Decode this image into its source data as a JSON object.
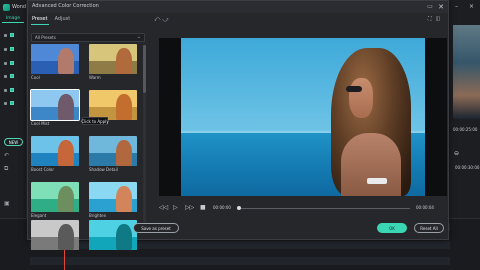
{
  "app": {
    "title_partial": "Wond"
  },
  "background": {
    "left_tab": "Image",
    "new_button": "NEW",
    "right_time_1": "00:00:25:00",
    "right_time_2": "00:00:30:00",
    "window_min": "–",
    "window_close": "×"
  },
  "dialog": {
    "title": "Advanced Color Correction",
    "minimize": "▭",
    "close": "✕",
    "tabs": [
      {
        "label": "Preset",
        "active": true
      },
      {
        "label": "Adjust",
        "active": false
      }
    ],
    "preset_filter": {
      "value": "All Presets"
    },
    "presets": [
      {
        "label": "Cool",
        "sky": "#4f88d6",
        "sea": "#2a5fb3",
        "girl": "#b27a6a"
      },
      {
        "label": "Warm",
        "sky": "#d6c57a",
        "sea": "#8f7b45",
        "girl": "#b06a3c"
      },
      {
        "label": "Cool Mist",
        "sky": "#8ec7ef",
        "sea": "#3d86c7",
        "girl": "#6e5a6a",
        "selected": true
      },
      {
        "label": "",
        "sky": "#f0c86a",
        "sea": "#c2943f",
        "girl": "#c36d2e"
      },
      {
        "label": "Boost Color",
        "sky": "#6cc2e9",
        "sea": "#1f83bf",
        "girl": "#c5663b"
      },
      {
        "label": "Shadow Detail",
        "sky": "#6fb8dc",
        "sea": "#2b7aa8",
        "girl": "#b2683f"
      },
      {
        "label": "Elegant",
        "sky": "#7fe0b8",
        "sea": "#2fae86",
        "girl": "#6d8f5f"
      },
      {
        "label": "Brighten",
        "sky": "#8ad8f2",
        "sea": "#2aa1cf",
        "girl": "#d2845a"
      },
      {
        "label": "",
        "sky": "#c9c9c9",
        "sea": "#7a7a7a",
        "girl": "#5a5a5a"
      },
      {
        "label": "",
        "sky": "#4ed2e3",
        "sea": "#11a6b9",
        "girl": "#0f7a86"
      }
    ],
    "tooltip": "Click to Apply",
    "save_button": "Save as preset",
    "player": {
      "current_time": "00:00:00",
      "total_time": "00:00:04",
      "progress": 0.0
    },
    "ok_button": "OK",
    "reset_button": "Reset All"
  },
  "colors": {
    "accent": "#3bd6b3",
    "playhead": "#e0463c"
  }
}
